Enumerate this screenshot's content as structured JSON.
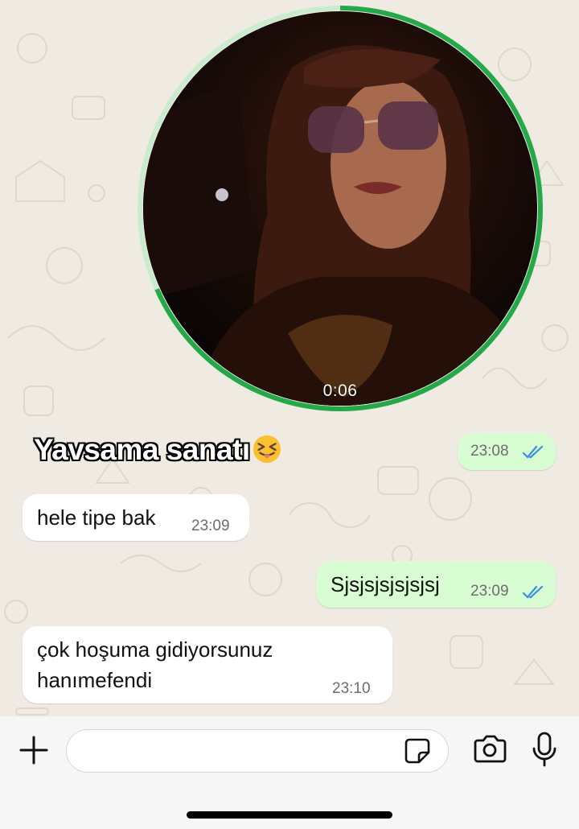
{
  "video_note": {
    "duration": "0:06"
  },
  "caption": {
    "text": "Yavsama sanatı",
    "emoji": "squinting-face-with-tongue"
  },
  "messages": [
    {
      "direction": "out",
      "text": "",
      "time": "23:08",
      "status": "read"
    },
    {
      "direction": "in",
      "text": "hele tipe bak",
      "time": "23:09"
    },
    {
      "direction": "out",
      "text": "Sjsjsjsjsjsjsj",
      "time": "23:09",
      "status": "read"
    },
    {
      "direction": "in",
      "text_lines": [
        "çok hoşuma gidiyorsunuz",
        "hanımefendi"
      ],
      "time": "23:10"
    }
  ],
  "input_bar": {
    "placeholder": "",
    "icons": [
      "plus-icon",
      "sticker-icon",
      "camera-icon",
      "microphone-icon"
    ]
  },
  "colors": {
    "accent_green": "#25a847",
    "outgoing_bubble": "#d9fdd3",
    "incoming_bubble": "#ffffff",
    "read_ticks": "#3a8fe6"
  }
}
